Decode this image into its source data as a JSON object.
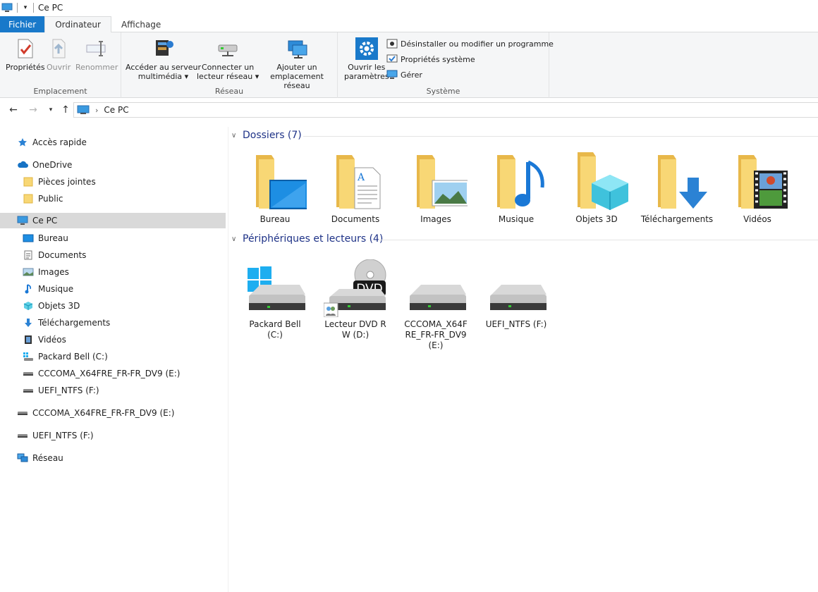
{
  "window": {
    "title": "Ce PC"
  },
  "ribbon_tabs": [
    {
      "label": "Fichier"
    },
    {
      "label": "Ordinateur"
    },
    {
      "label": "Affichage"
    }
  ],
  "ribbon": {
    "emplacement": {
      "label": "Emplacement",
      "proprietes": "Propriétés",
      "ouvrir": "Ouvrir",
      "renommer": "Renommer"
    },
    "reseau": {
      "label": "Réseau",
      "acceder_l1": "Accéder au serveur",
      "acceder_l2": "multimédia",
      "connecter_l1": "Connecter un",
      "connecter_l2": "lecteur réseau",
      "ajouter_l1": "Ajouter un",
      "ajouter_l2": "emplacement réseau"
    },
    "systeme": {
      "label": "Système",
      "ouvrir_l1": "Ouvrir les",
      "ouvrir_l2": "paramètres",
      "desinstaller": "Désinstaller ou modifier un programme",
      "proprietes_systeme": "Propriétés système",
      "gerer": "Gérer"
    }
  },
  "address": {
    "path": "Ce PC"
  },
  "sidebar": {
    "items": [
      {
        "label": "Accès rapide",
        "icon": "star-icon"
      },
      {
        "label": "OneDrive",
        "icon": "cloud-icon"
      },
      {
        "label": "Pièces jointes",
        "icon": "folder-icon"
      },
      {
        "label": "Public",
        "icon": "folder-icon"
      },
      {
        "label": "Ce PC",
        "icon": "computer-icon"
      },
      {
        "label": "Bureau",
        "icon": "desktop-icon"
      },
      {
        "label": "Documents",
        "icon": "documents-icon"
      },
      {
        "label": "Images",
        "icon": "images-icon"
      },
      {
        "label": "Musique",
        "icon": "music-icon"
      },
      {
        "label": "Objets 3D",
        "icon": "cube-icon"
      },
      {
        "label": "Téléchargements",
        "icon": "download-icon"
      },
      {
        "label": "Vidéos",
        "icon": "video-icon"
      },
      {
        "label": "Packard Bell (C:)",
        "icon": "windows-drive-icon"
      },
      {
        "label": "CCCOMA_X64FRE_FR-FR_DV9 (E:)",
        "icon": "drive-icon"
      },
      {
        "label": "UEFI_NTFS (F:)",
        "icon": "drive-icon"
      },
      {
        "label": "CCCOMA_X64FRE_FR-FR_DV9 (E:)",
        "icon": "drive-icon"
      },
      {
        "label": "UEFI_NTFS (F:)",
        "icon": "drive-icon"
      },
      {
        "label": "Réseau",
        "icon": "network-icon"
      }
    ]
  },
  "content": {
    "folders_header": "Dossiers (7)",
    "folders": [
      {
        "label": "Bureau"
      },
      {
        "label": "Documents"
      },
      {
        "label": "Images"
      },
      {
        "label": "Musique"
      },
      {
        "label": "Objets 3D"
      },
      {
        "label": "Téléchargements"
      },
      {
        "label": "Vidéos"
      }
    ],
    "devices_header": "Périphériques et lecteurs (4)",
    "devices": [
      {
        "label": "Packard Bell (C:)"
      },
      {
        "label": "Lecteur DVD RW (D:)",
        "badge": "DVD"
      },
      {
        "label": "CCCOMA_X64FRE_FR-FR_DV9 (E:)"
      },
      {
        "label": "UEFI_NTFS (F:)"
      }
    ]
  },
  "colors": {
    "accent": "#1979ca",
    "folder": "#f8d775",
    "folder_dark": "#e8b84a",
    "header_text": "#1e3287",
    "selected": "#d9d9d9"
  }
}
